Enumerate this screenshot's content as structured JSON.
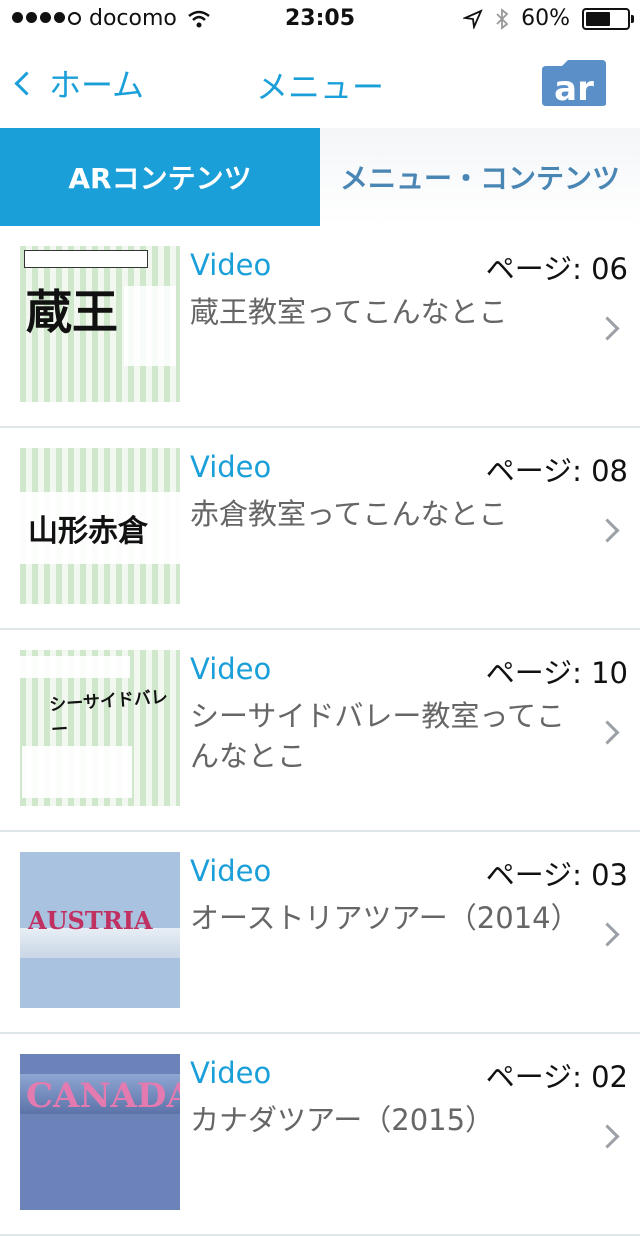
{
  "status_bar": {
    "carrier": "docomo",
    "time": "23:05",
    "battery": "60%",
    "battery_level": 0.6
  },
  "nav": {
    "back_label": "ホーム",
    "title": "メニュー",
    "ar_label": "ar"
  },
  "tabs": [
    {
      "label": "ARコンテンツ",
      "active": true
    },
    {
      "label": "メニュー・コンテンツ",
      "active": false
    }
  ],
  "items": [
    {
      "type": "Video",
      "page": "ページ: 06",
      "title": "蔵王教室ってこんなとこ",
      "thumb_title": "蔵王"
    },
    {
      "type": "Video",
      "page": "ページ: 08",
      "title": "赤倉教室ってこんなとこ",
      "thumb_title": "山形赤倉"
    },
    {
      "type": "Video",
      "page": "ページ: 10",
      "title": "シーサイドバレー教室ってこんなとこ",
      "thumb_title": "シーサイドバレー"
    },
    {
      "type": "Video",
      "page": "ページ: 03",
      "title": "オーストリアツアー（2014）",
      "thumb_title": "AUSTRIA"
    },
    {
      "type": "Video",
      "page": "ページ: 02",
      "title": "カナダツアー（2015）",
      "thumb_title": "CANADA"
    }
  ],
  "colors": {
    "accent": "#1a9fd9",
    "inactive_tab_text": "#4a86b4",
    "title_gray": "#666666",
    "divider": "#dfe6ea"
  }
}
